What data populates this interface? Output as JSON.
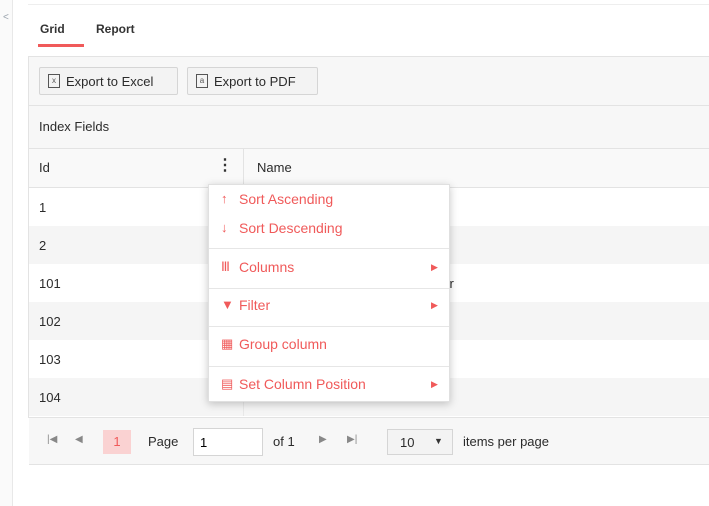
{
  "tabs": [
    {
      "label": "Grid"
    },
    {
      "label": "Report"
    }
  ],
  "toolbar": {
    "excel_label": "Export to Excel",
    "pdf_label": "Export to PDF"
  },
  "group_panel": {
    "label": "Index Fields"
  },
  "columns": {
    "id": "Id",
    "name": "Name"
  },
  "rows": [
    {
      "id": "1",
      "name": ""
    },
    {
      "id": "2",
      "name": ""
    },
    {
      "id": "101",
      "name": "ber"
    },
    {
      "id": "102",
      "name": ""
    },
    {
      "id": "103",
      "name": ""
    },
    {
      "id": "104",
      "name": ""
    }
  ],
  "column_menu": {
    "sort_asc": "Sort Ascending",
    "sort_desc": "Sort Descending",
    "columns": "Columns",
    "filter": "Filter",
    "group": "Group column",
    "set_position": "Set Column Position"
  },
  "pager": {
    "current_page": "1",
    "page_label": "Page",
    "page_input": "1",
    "of_label": "of 1",
    "page_size": "10",
    "items_label": "items per page"
  },
  "colors": {
    "accent": "#f05a5a",
    "selected_page_bg": "#fad2d2"
  }
}
